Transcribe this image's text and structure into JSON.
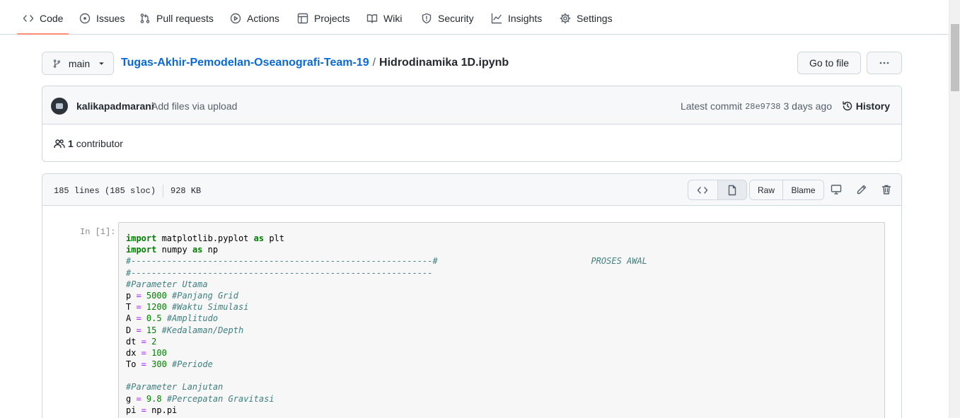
{
  "nav": {
    "items": [
      {
        "label": "Code",
        "icon": "code-icon"
      },
      {
        "label": "Issues",
        "icon": "issue-icon"
      },
      {
        "label": "Pull requests",
        "icon": "pull-request-icon"
      },
      {
        "label": "Actions",
        "icon": "play-icon"
      },
      {
        "label": "Projects",
        "icon": "table-icon"
      },
      {
        "label": "Wiki",
        "icon": "book-icon"
      },
      {
        "label": "Security",
        "icon": "shield-icon"
      },
      {
        "label": "Insights",
        "icon": "graph-icon"
      },
      {
        "label": "Settings",
        "icon": "gear-icon"
      }
    ],
    "selected": "Code",
    "accent": "#fd8c73"
  },
  "branch": {
    "label": "main"
  },
  "breadcrumb": {
    "repo": "Tugas-Akhir-Pemodelan-Oseanografi-Team-19",
    "separator": "/",
    "file": "Hidrodinamika 1D.ipynb"
  },
  "actions": {
    "go_to_file": "Go to file",
    "more": "···"
  },
  "commit": {
    "author": "kalikapadmarani",
    "message": "Add files via upload",
    "latest_label": "Latest commit",
    "sha": "28e9738",
    "age": "3 days ago",
    "history_label": "History"
  },
  "contributors": {
    "count": "1",
    "label": "contributor"
  },
  "file": {
    "lines": "185 lines (185 sloc)",
    "size": "928 KB",
    "raw_label": "Raw",
    "blame_label": "Blame"
  },
  "cell": {
    "prompt": "In [1]:",
    "code": [
      {
        "k": "import",
        "t1": " matplotlib.pyplot ",
        "k2": "as",
        "t2": " plt"
      },
      {
        "k": "import",
        "t1": " numpy ",
        "k2": "as",
        "t2": " np"
      },
      {
        "c": "#-----------------------------------------------------------#                              PROSES AWAL"
      },
      {
        "c": "#-----------------------------------------------------------"
      },
      {
        "c": "#Parameter Utama"
      },
      {
        "v": "p",
        "o": " = ",
        "n": "5000",
        "c": " #Panjang Grid"
      },
      {
        "v": "T",
        "o": " = ",
        "n": "1200",
        "c": " #Waktu Simulasi"
      },
      {
        "v": "A",
        "o": " = ",
        "n": "0.5",
        "c": " #Amplitudo"
      },
      {
        "v": "D",
        "o": " = ",
        "n": "15",
        "c": " #Kedalaman/Depth"
      },
      {
        "v": "dt",
        "o": " = ",
        "n": "2",
        "c": ""
      },
      {
        "v": "dx",
        "o": " = ",
        "n": "100",
        "c": ""
      },
      {
        "v": "To",
        "o": " = ",
        "n": "300",
        "c": " #Periode"
      },
      {
        "blank": ""
      },
      {
        "c": "#Parameter Lanjutan"
      },
      {
        "v": "g",
        "o": " = ",
        "n": "9.8",
        "c": " #Percepatan Gravitasi"
      },
      {
        "v": "pi",
        "o": " = ",
        "n": "",
        "c": "",
        "t": "np.pi"
      }
    ]
  }
}
